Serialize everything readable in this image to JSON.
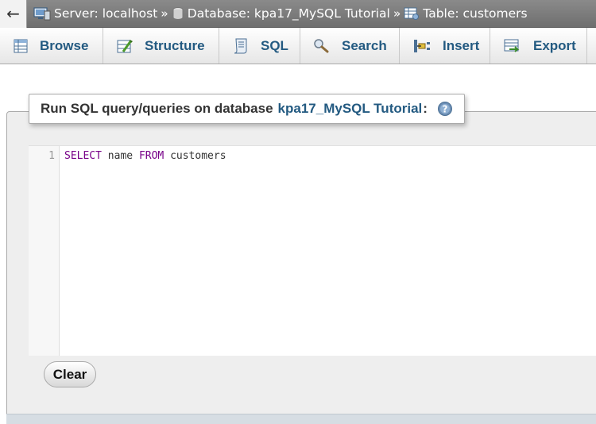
{
  "breadcrumb": {
    "back": "←",
    "server_label": "Server: localhost",
    "database_label": "Database: kpa17_MySQL Tutorial",
    "table_label": "Table: customers",
    "separator": "»"
  },
  "tabs": [
    {
      "label": "Browse",
      "icon": "browse-icon"
    },
    {
      "label": "Structure",
      "icon": "structure-icon"
    },
    {
      "label": "SQL",
      "icon": "sql-icon"
    },
    {
      "label": "Search",
      "icon": "search-icon"
    },
    {
      "label": "Insert",
      "icon": "insert-icon"
    },
    {
      "label": "Export",
      "icon": "export-icon"
    }
  ],
  "query_panel": {
    "legend_prefix": "Run SQL query/queries on database",
    "database_name": "kpa17_MySQL Tutorial",
    "legend_suffix": ":",
    "help_icon": "help-icon"
  },
  "editor": {
    "line_number": "1",
    "tokens": [
      "SELECT",
      " name ",
      "FROM",
      " customers"
    ]
  },
  "buttons": {
    "clear": "Clear"
  },
  "colors": {
    "link": "#235a81",
    "keyword": "#770088",
    "topbar": "#777777"
  }
}
